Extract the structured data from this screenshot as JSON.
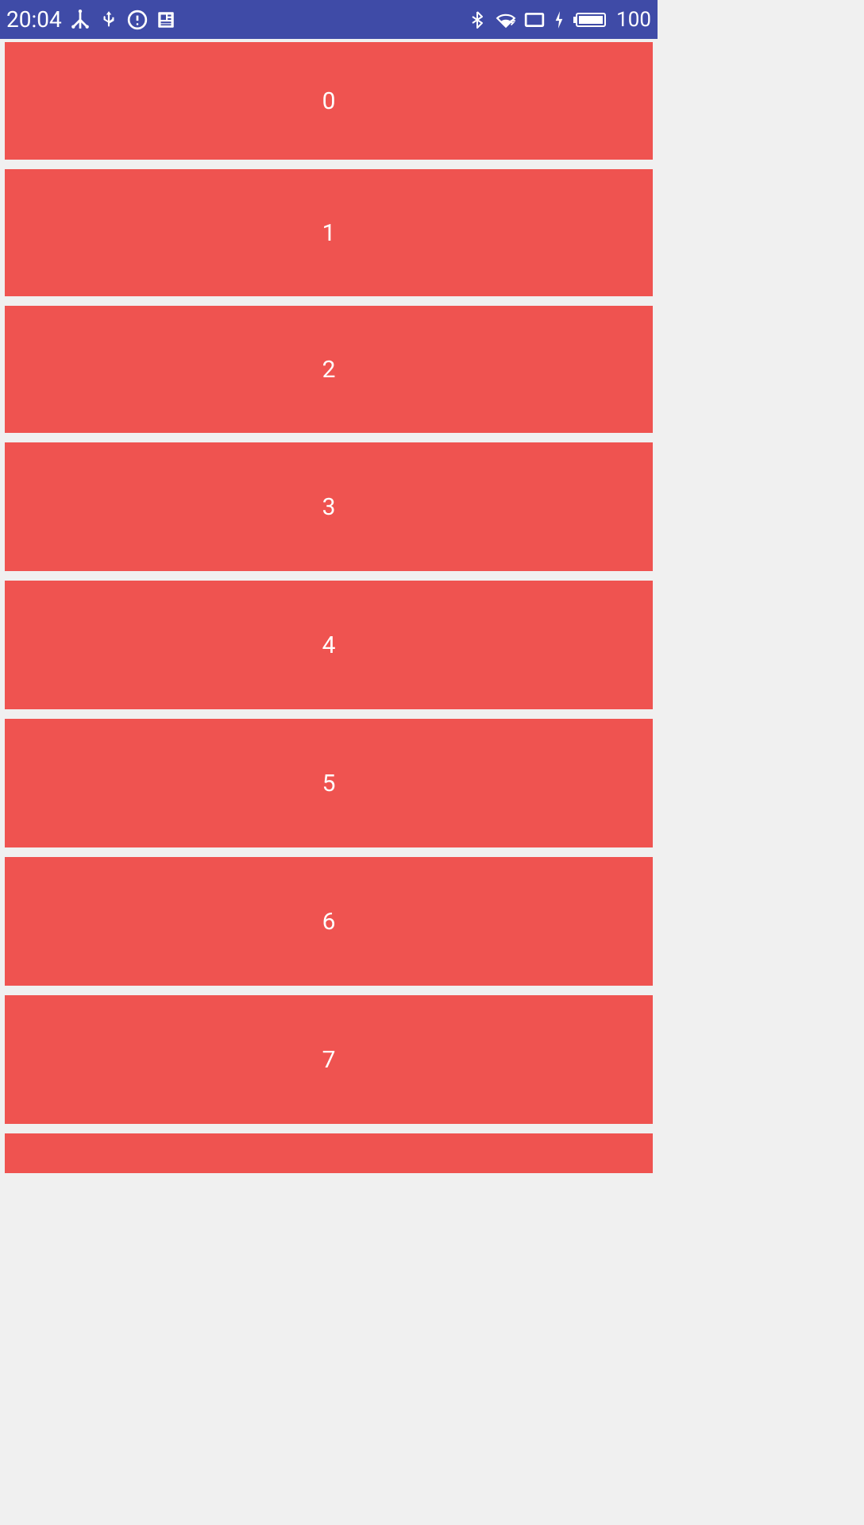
{
  "statusBar": {
    "time": "20:04",
    "batteryLevel": "100",
    "icons": {
      "graph": "graph-icon",
      "usb": "usb-icon",
      "alert": "alert-circle-icon",
      "news": "news-icon",
      "bluetooth": "bluetooth-icon",
      "wifi": "wifi-icon",
      "screen": "screen-icon",
      "charging": "charging-icon",
      "battery": "battery-icon"
    }
  },
  "colors": {
    "statusBarBg": "#3F4BA7",
    "itemBg": "#EF5350",
    "pageBg": "#f0f0f0",
    "textColor": "#ffffff"
  },
  "list": {
    "items": [
      {
        "label": "0"
      },
      {
        "label": "1"
      },
      {
        "label": "2"
      },
      {
        "label": "3"
      },
      {
        "label": "4"
      },
      {
        "label": "5"
      },
      {
        "label": "6"
      },
      {
        "label": "7"
      }
    ]
  }
}
